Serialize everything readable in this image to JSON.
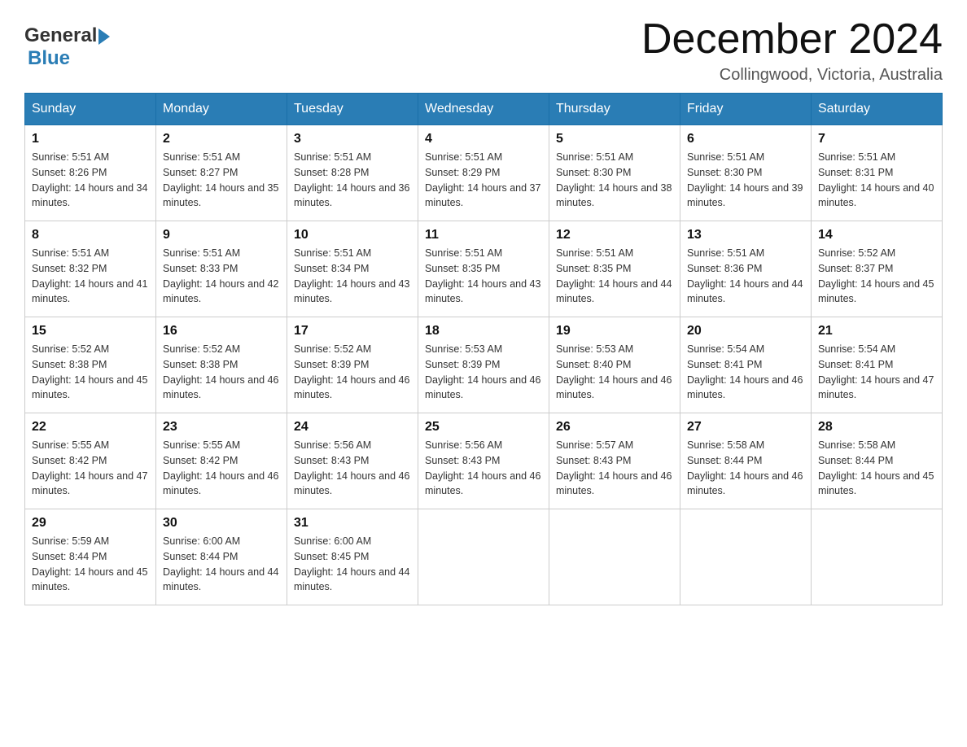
{
  "header": {
    "logo_general": "General",
    "logo_blue": "Blue",
    "title": "December 2024",
    "location": "Collingwood, Victoria, Australia"
  },
  "calendar": {
    "days_of_week": [
      "Sunday",
      "Monday",
      "Tuesday",
      "Wednesday",
      "Thursday",
      "Friday",
      "Saturday"
    ],
    "weeks": [
      [
        {
          "day": 1,
          "sunrise": "5:51 AM",
          "sunset": "8:26 PM",
          "daylight": "14 hours and 34 minutes."
        },
        {
          "day": 2,
          "sunrise": "5:51 AM",
          "sunset": "8:27 PM",
          "daylight": "14 hours and 35 minutes."
        },
        {
          "day": 3,
          "sunrise": "5:51 AM",
          "sunset": "8:28 PM",
          "daylight": "14 hours and 36 minutes."
        },
        {
          "day": 4,
          "sunrise": "5:51 AM",
          "sunset": "8:29 PM",
          "daylight": "14 hours and 37 minutes."
        },
        {
          "day": 5,
          "sunrise": "5:51 AM",
          "sunset": "8:30 PM",
          "daylight": "14 hours and 38 minutes."
        },
        {
          "day": 6,
          "sunrise": "5:51 AM",
          "sunset": "8:30 PM",
          "daylight": "14 hours and 39 minutes."
        },
        {
          "day": 7,
          "sunrise": "5:51 AM",
          "sunset": "8:31 PM",
          "daylight": "14 hours and 40 minutes."
        }
      ],
      [
        {
          "day": 8,
          "sunrise": "5:51 AM",
          "sunset": "8:32 PM",
          "daylight": "14 hours and 41 minutes."
        },
        {
          "day": 9,
          "sunrise": "5:51 AM",
          "sunset": "8:33 PM",
          "daylight": "14 hours and 42 minutes."
        },
        {
          "day": 10,
          "sunrise": "5:51 AM",
          "sunset": "8:34 PM",
          "daylight": "14 hours and 43 minutes."
        },
        {
          "day": 11,
          "sunrise": "5:51 AM",
          "sunset": "8:35 PM",
          "daylight": "14 hours and 43 minutes."
        },
        {
          "day": 12,
          "sunrise": "5:51 AM",
          "sunset": "8:35 PM",
          "daylight": "14 hours and 44 minutes."
        },
        {
          "day": 13,
          "sunrise": "5:51 AM",
          "sunset": "8:36 PM",
          "daylight": "14 hours and 44 minutes."
        },
        {
          "day": 14,
          "sunrise": "5:52 AM",
          "sunset": "8:37 PM",
          "daylight": "14 hours and 45 minutes."
        }
      ],
      [
        {
          "day": 15,
          "sunrise": "5:52 AM",
          "sunset": "8:38 PM",
          "daylight": "14 hours and 45 minutes."
        },
        {
          "day": 16,
          "sunrise": "5:52 AM",
          "sunset": "8:38 PM",
          "daylight": "14 hours and 46 minutes."
        },
        {
          "day": 17,
          "sunrise": "5:52 AM",
          "sunset": "8:39 PM",
          "daylight": "14 hours and 46 minutes."
        },
        {
          "day": 18,
          "sunrise": "5:53 AM",
          "sunset": "8:39 PM",
          "daylight": "14 hours and 46 minutes."
        },
        {
          "day": 19,
          "sunrise": "5:53 AM",
          "sunset": "8:40 PM",
          "daylight": "14 hours and 46 minutes."
        },
        {
          "day": 20,
          "sunrise": "5:54 AM",
          "sunset": "8:41 PM",
          "daylight": "14 hours and 46 minutes."
        },
        {
          "day": 21,
          "sunrise": "5:54 AM",
          "sunset": "8:41 PM",
          "daylight": "14 hours and 47 minutes."
        }
      ],
      [
        {
          "day": 22,
          "sunrise": "5:55 AM",
          "sunset": "8:42 PM",
          "daylight": "14 hours and 47 minutes."
        },
        {
          "day": 23,
          "sunrise": "5:55 AM",
          "sunset": "8:42 PM",
          "daylight": "14 hours and 46 minutes."
        },
        {
          "day": 24,
          "sunrise": "5:56 AM",
          "sunset": "8:43 PM",
          "daylight": "14 hours and 46 minutes."
        },
        {
          "day": 25,
          "sunrise": "5:56 AM",
          "sunset": "8:43 PM",
          "daylight": "14 hours and 46 minutes."
        },
        {
          "day": 26,
          "sunrise": "5:57 AM",
          "sunset": "8:43 PM",
          "daylight": "14 hours and 46 minutes."
        },
        {
          "day": 27,
          "sunrise": "5:58 AM",
          "sunset": "8:44 PM",
          "daylight": "14 hours and 46 minutes."
        },
        {
          "day": 28,
          "sunrise": "5:58 AM",
          "sunset": "8:44 PM",
          "daylight": "14 hours and 45 minutes."
        }
      ],
      [
        {
          "day": 29,
          "sunrise": "5:59 AM",
          "sunset": "8:44 PM",
          "daylight": "14 hours and 45 minutes."
        },
        {
          "day": 30,
          "sunrise": "6:00 AM",
          "sunset": "8:44 PM",
          "daylight": "14 hours and 44 minutes."
        },
        {
          "day": 31,
          "sunrise": "6:00 AM",
          "sunset": "8:45 PM",
          "daylight": "14 hours and 44 minutes."
        },
        null,
        null,
        null,
        null
      ]
    ]
  }
}
